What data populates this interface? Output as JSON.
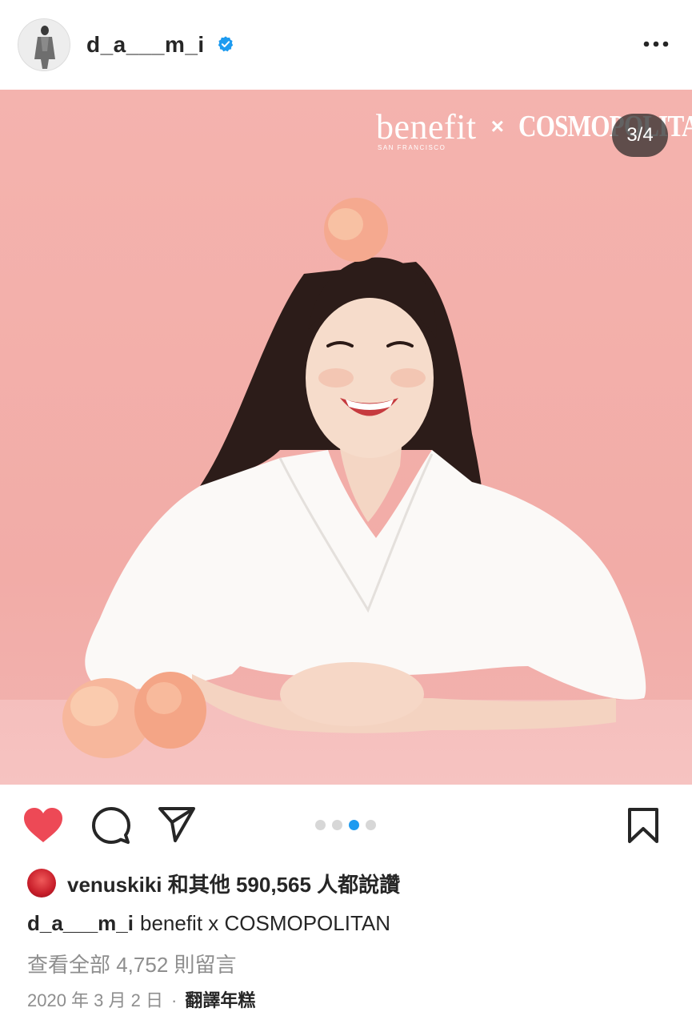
{
  "post": {
    "username": "d_a___m_i",
    "verified": true,
    "more_icon": "more-horizontal-icon",
    "image_counter": "3/4",
    "image_brand_left": "benefit",
    "image_brand_left_sub": "SAN FRANCISCO",
    "image_brand_x": "×",
    "image_brand_right": "COSMOPOLITAN",
    "carousel": {
      "total": 4,
      "current": 3
    }
  },
  "actions": {
    "like_icon": "heart-filled-icon",
    "comment_icon": "comment-icon",
    "share_icon": "paper-plane-icon",
    "save_icon": "bookmark-icon",
    "like_color": "#ed4956",
    "active_dot_color": "#1d9bf0"
  },
  "likes": {
    "text": "venuskiki 和其他 590,565 人都說讚"
  },
  "caption": {
    "username": "d_a___m_i",
    "text": "benefit x COSMOPOLITAN"
  },
  "comments": {
    "view_all": "查看全部 4,752 則留言"
  },
  "meta": {
    "date": "2020 年 3 月 2 日",
    "separator": "·",
    "translate": "翻譯年糕"
  }
}
